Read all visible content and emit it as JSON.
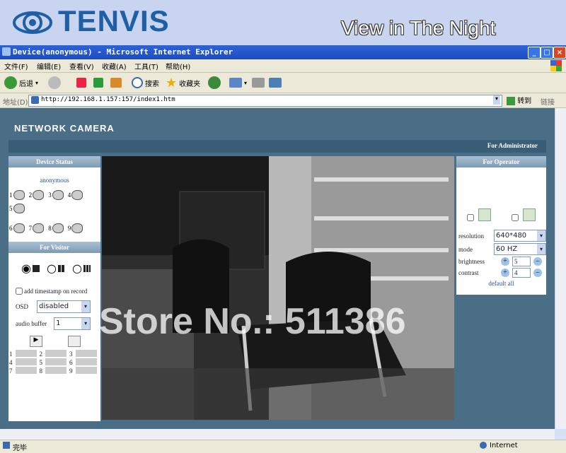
{
  "banner": {
    "brand": "TENVIS",
    "caption": "View in The Night"
  },
  "window": {
    "title": "Device(anonymous) - Microsoft Internet Explorer",
    "minimize": "_",
    "maximize": "□",
    "close": "×"
  },
  "menu": [
    "文件(F)",
    "编辑(E)",
    "查看(V)",
    "收藏(A)",
    "工具(T)",
    "帮助(H)"
  ],
  "toolbar": {
    "back": "后退",
    "search": "搜索",
    "favorites": "收藏夹"
  },
  "address": {
    "label": "地址(D)",
    "url": "http://192.168.1.157:157/index1.htm",
    "go": "转到",
    "links": "链接"
  },
  "page": {
    "title": "NETWORK CAMERA",
    "admin_label": "For Administrator",
    "device_status": {
      "header": "Device Status",
      "user": "anonymous",
      "cameras": [
        "1",
        "2",
        "3",
        "4",
        "5",
        "6",
        "7",
        "8",
        "9"
      ]
    },
    "visitor": {
      "header": "For Visitor",
      "timestamp_label": "add timestamp on record",
      "osd_label": "OSD",
      "osd_value": "disabled",
      "audio_label": "audio buffer",
      "audio_value": "1",
      "grid": [
        "1",
        "2",
        "3",
        "4",
        "5",
        "6",
        "7",
        "8",
        "9"
      ]
    },
    "operator": {
      "header": "For Operator",
      "resolution_label": "resolution",
      "resolution_value": "640*480",
      "mode_label": "mode",
      "mode_value": "60 HZ",
      "brightness_label": "brightness",
      "brightness_value": "5",
      "contrast_label": "contrast",
      "contrast_value": "4",
      "default_label": "default all"
    }
  },
  "watermark": "Store No.: 511386",
  "status": {
    "left": "完毕",
    "zone": "Internet"
  }
}
